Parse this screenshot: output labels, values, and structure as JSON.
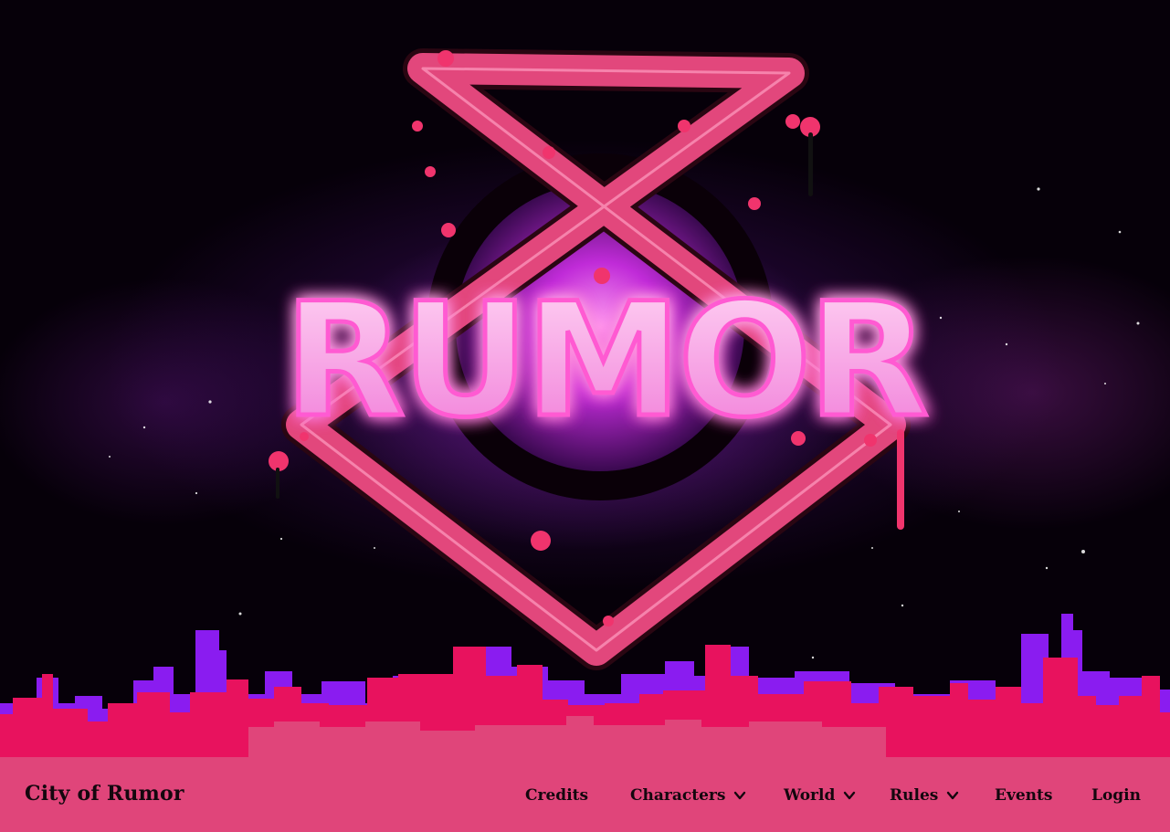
{
  "logo": {
    "text": "RUMOR"
  },
  "site": {
    "title": "City of Rumor"
  },
  "nav": {
    "items": [
      {
        "label": "Credits",
        "dropdown": false
      },
      {
        "label": "Characters",
        "dropdown": true
      },
      {
        "label": "World",
        "dropdown": true
      },
      {
        "label": "Rules",
        "dropdown": true
      },
      {
        "label": "Events",
        "dropdown": false
      },
      {
        "label": "Login",
        "dropdown": false
      }
    ]
  },
  "colors": {
    "navbar": "#e0457a",
    "skyline_pink": "#e8125e",
    "skyline_violet": "#8a1cf0",
    "pentagram": "#e2477c",
    "logo_glow": "#ff5ad2",
    "background": "#060009"
  },
  "icons": {
    "dropdown": "chevron-down-icon",
    "logo": "pentagram-emblem"
  }
}
